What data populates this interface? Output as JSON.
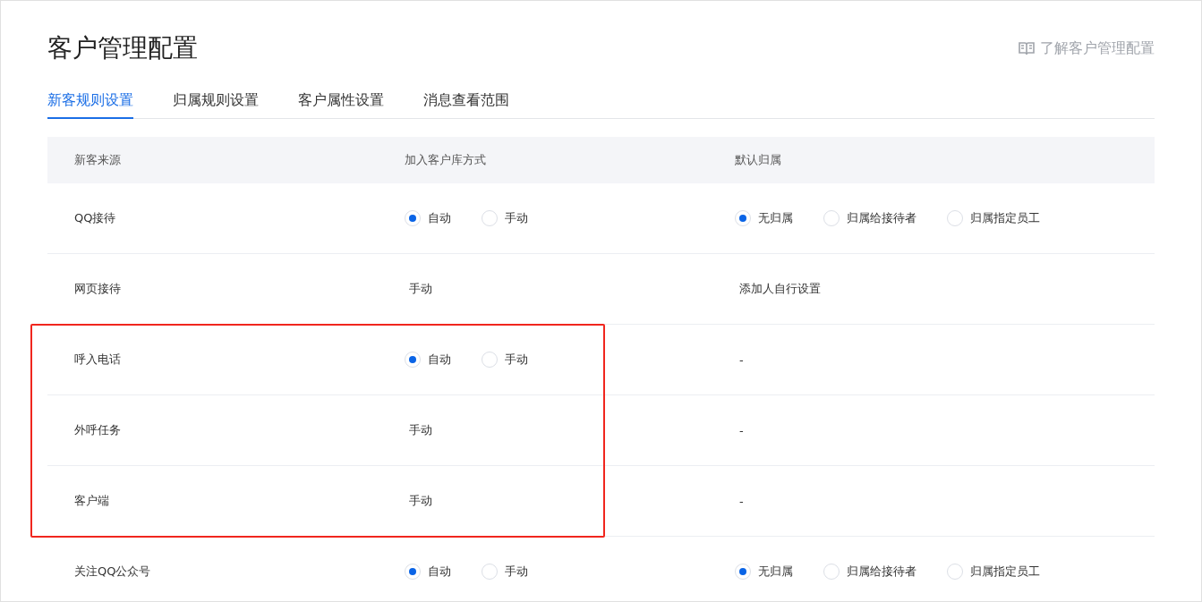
{
  "title": "客户管理配置",
  "help_link": "了解客户管理配置",
  "tabs": [
    {
      "label": "新客规则设置",
      "selected": true
    },
    {
      "label": "归属规则设置",
      "selected": false
    },
    {
      "label": "客户属性设置",
      "selected": false
    },
    {
      "label": "消息查看范围",
      "selected": false
    }
  ],
  "table": {
    "columns": [
      "新客来源",
      "加入客户库方式",
      "默认归属"
    ],
    "rows": [
      {
        "source": "QQ接待",
        "highlighted": false,
        "method": {
          "kind": "radio",
          "options": [
            {
              "label": "自动",
              "selected": true
            },
            {
              "label": "手动",
              "selected": false
            }
          ]
        },
        "owner": {
          "kind": "radio",
          "options": [
            {
              "label": "无归属",
              "selected": true
            },
            {
              "label": "归属给接待者",
              "selected": false
            },
            {
              "label": "归属指定员工",
              "selected": false
            }
          ]
        }
      },
      {
        "source": "网页接待",
        "highlighted": false,
        "method": {
          "kind": "text",
          "text": "手动"
        },
        "owner": {
          "kind": "text",
          "text": "添加人自行设置"
        }
      },
      {
        "source": "呼入电话",
        "highlighted": true,
        "method": {
          "kind": "radio",
          "options": [
            {
              "label": "自动",
              "selected": true
            },
            {
              "label": "手动",
              "selected": false
            }
          ]
        },
        "owner": {
          "kind": "text",
          "text": "-"
        }
      },
      {
        "source": "外呼任务",
        "highlighted": true,
        "method": {
          "kind": "text",
          "text": "手动"
        },
        "owner": {
          "kind": "text",
          "text": "-"
        }
      },
      {
        "source": "客户端",
        "highlighted": true,
        "method": {
          "kind": "text",
          "text": "手动"
        },
        "owner": {
          "kind": "text",
          "text": "-"
        }
      },
      {
        "source": "关注QQ公众号",
        "highlighted": false,
        "method": {
          "kind": "radio",
          "options": [
            {
              "label": "自动",
              "selected": true
            },
            {
              "label": "手动",
              "selected": false
            }
          ]
        },
        "owner": {
          "kind": "radio",
          "options": [
            {
              "label": "无归属",
              "selected": true
            },
            {
              "label": "归属给接待者",
              "selected": false
            },
            {
              "label": "归属指定员工",
              "selected": false
            }
          ]
        }
      }
    ]
  }
}
